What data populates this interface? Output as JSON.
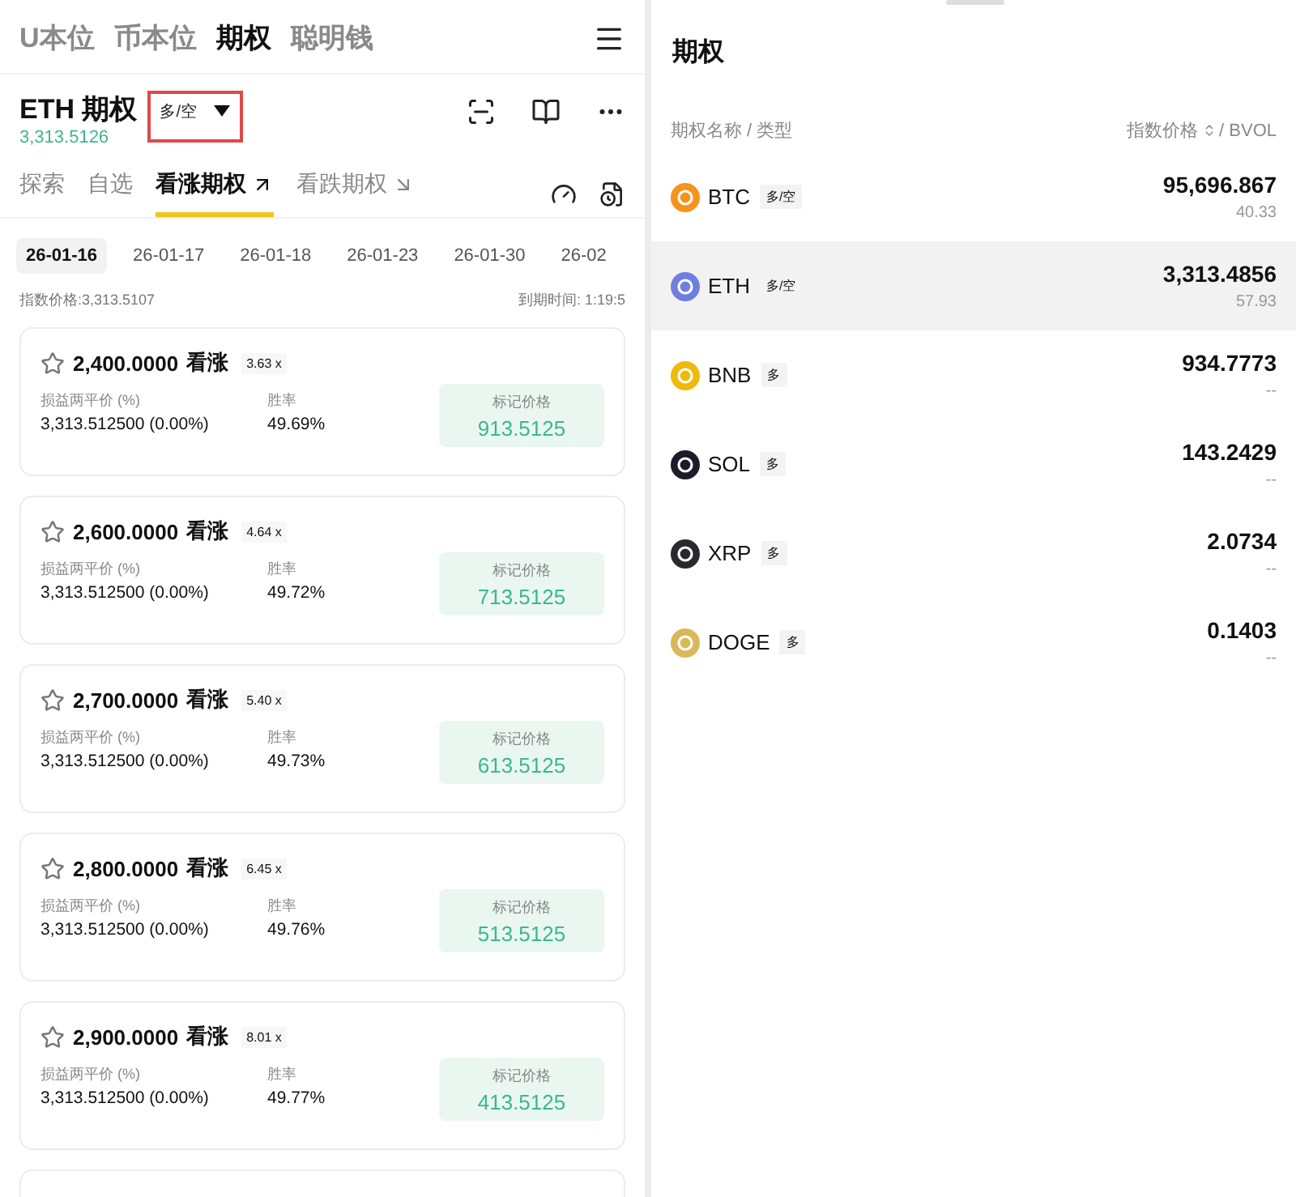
{
  "top_tabs": [
    {
      "label": "U本位",
      "selected": false
    },
    {
      "label": "币本位",
      "selected": false
    },
    {
      "label": "期权",
      "selected": true
    },
    {
      "label": "聪明钱",
      "selected": false
    }
  ],
  "header": {
    "title": "ETH 期权",
    "price": "3,313.5126",
    "mode": "多/空",
    "mode_highlighted": true
  },
  "sub_tabs": [
    {
      "label": "探索",
      "selected": false,
      "kind": "plain"
    },
    {
      "label": "自选",
      "selected": false,
      "kind": "plain"
    },
    {
      "label": "看涨期权",
      "selected": true,
      "kind": "rising"
    },
    {
      "label": "看跌期权",
      "selected": false,
      "kind": "falling"
    }
  ],
  "dates": [
    {
      "label": "26-01-16",
      "selected": true
    },
    {
      "label": "26-01-17",
      "selected": false
    },
    {
      "label": "26-01-18",
      "selected": false
    },
    {
      "label": "26-01-23",
      "selected": false
    },
    {
      "label": "26-01-30",
      "selected": false
    },
    {
      "label": "26-02",
      "selected": false
    }
  ],
  "index_price": "指数价格:3,313.5107",
  "expiry": "到期时间: 1:19:5",
  "cards": [
    {
      "strike": "2,400.0000",
      "direction": "看涨",
      "leverage": "3.63 x",
      "starred": false,
      "breakeven_label": "损益两平价 (%)",
      "breakeven": "3,313.512500 (0.00%)",
      "win_label": "胜率",
      "win": "49.69%",
      "mark_label": "标记价格",
      "mark": "913.5125"
    },
    {
      "strike": "2,600.0000",
      "direction": "看涨",
      "leverage": "4.64 x",
      "starred": false,
      "breakeven_label": "损益两平价 (%)",
      "breakeven": "3,313.512500 (0.00%)",
      "win_label": "胜率",
      "win": "49.72%",
      "mark_label": "标记价格",
      "mark": "713.5125"
    },
    {
      "strike": "2,700.0000",
      "direction": "看涨",
      "leverage": "5.40 x",
      "starred": false,
      "breakeven_label": "损益两平价 (%)",
      "breakeven": "3,313.512500 (0.00%)",
      "win_label": "胜率",
      "win": "49.73%",
      "mark_label": "标记价格",
      "mark": "613.5125"
    },
    {
      "strike": "2,800.0000",
      "direction": "看涨",
      "leverage": "6.45 x",
      "starred": false,
      "breakeven_label": "损益两平价 (%)",
      "breakeven": "3,313.512500 (0.00%)",
      "win_label": "胜率",
      "win": "49.76%",
      "mark_label": "标记价格",
      "mark": "513.5125"
    },
    {
      "strike": "2,900.0000",
      "direction": "看涨",
      "leverage": "8.01 x",
      "starred": false,
      "breakeven_label": "损益两平价 (%)",
      "breakeven": "3,313.512500 (0.00%)",
      "win_label": "胜率",
      "win": "49.77%",
      "mark_label": "标记价格",
      "mark": "413.5125"
    }
  ],
  "sheet": {
    "title": "期权",
    "name_header": "期权名称 / 类型",
    "price_header": "指数价格",
    "bvol_header": "/ BVOL",
    "coins": [
      {
        "symbol": "BTC",
        "tag": "多/空",
        "price": "95,696.867",
        "bvol": "40.33",
        "color": "#f7931a",
        "selected": false
      },
      {
        "symbol": "ETH",
        "tag": "多/空",
        "price": "3,313.4856",
        "bvol": "57.93",
        "color": "#6f7fe0",
        "selected": true
      },
      {
        "symbol": "BNB",
        "tag": "多",
        "price": "934.7773",
        "bvol": "--",
        "color": "#f0b90b",
        "selected": false
      },
      {
        "symbol": "SOL",
        "tag": "多",
        "price": "143.2429",
        "bvol": "--",
        "color": "#1b1b2a",
        "selected": false
      },
      {
        "symbol": "XRP",
        "tag": "多",
        "price": "2.0734",
        "bvol": "--",
        "color": "#2a2a2e",
        "selected": false
      },
      {
        "symbol": "DOGE",
        "tag": "多",
        "price": "0.1403",
        "bvol": "--",
        "color": "#d9b85a",
        "selected": false
      }
    ]
  }
}
